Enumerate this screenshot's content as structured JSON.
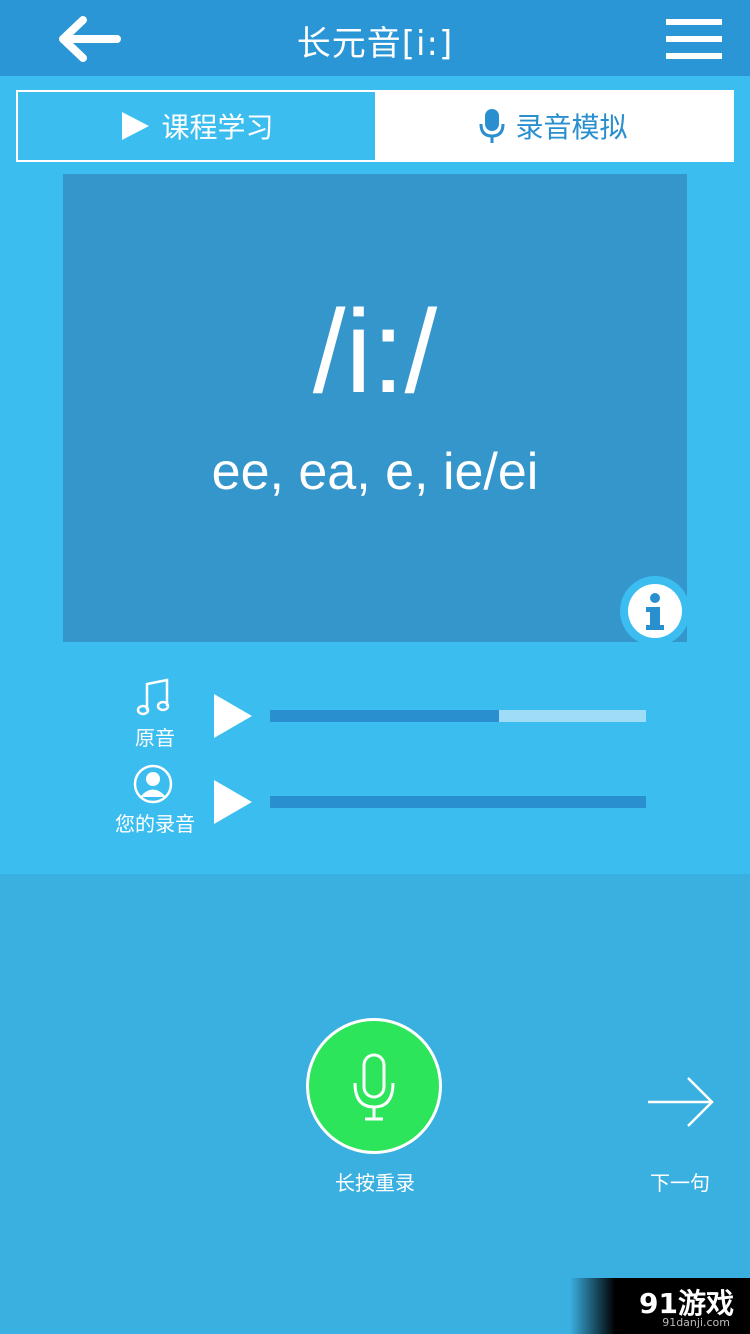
{
  "header": {
    "title": "长元音[i:]",
    "back_icon": "arrow-left-icon",
    "menu_icon": "hamburger-menu-icon"
  },
  "tabs": [
    {
      "label": "课程学习",
      "icon": "play-icon",
      "state": "active"
    },
    {
      "label": "录音模拟",
      "icon": "microphone-icon",
      "state": "inactive"
    }
  ],
  "card": {
    "phonetic": "/i:/",
    "spellings": "ee, ea, e, ie/ei",
    "info_icon": "info-icon"
  },
  "players": [
    {
      "label": "原音",
      "icon": "music-note-icon",
      "progress": 0.61
    },
    {
      "label": "您的录音",
      "icon": "user-avatar-icon",
      "progress": 1.0
    }
  ],
  "actions": {
    "record_label": "长按重录",
    "next_label": "下一句"
  },
  "watermark": {
    "text": "91游戏",
    "sub": "91danji.com"
  },
  "colors": {
    "header": "#2a96d6",
    "panel": "#3cbdf0",
    "card": "#3596cc",
    "record_button": "#2de55a"
  }
}
